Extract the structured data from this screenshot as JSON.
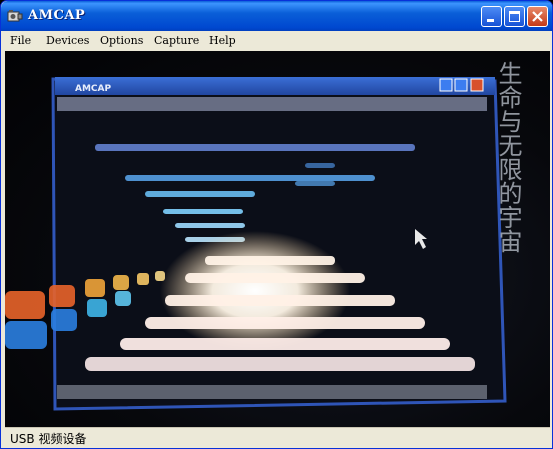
{
  "window": {
    "title": "AMCAP"
  },
  "menu": [
    {
      "label": "File"
    },
    {
      "label": "Devices"
    },
    {
      "label": "Options"
    },
    {
      "label": "Capture"
    },
    {
      "label": "Help"
    }
  ],
  "video": {
    "inner_window_title": "AMCAP",
    "overlay_chinese_text": "生命与无限的宇宙"
  },
  "status": {
    "text": "USB 视频设备"
  }
}
